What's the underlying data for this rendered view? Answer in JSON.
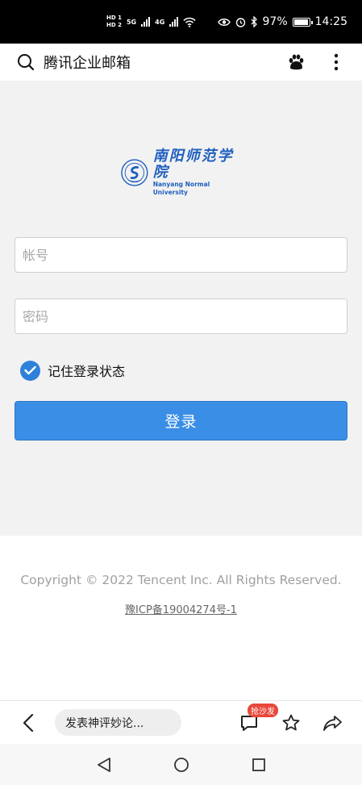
{
  "status_bar": {
    "sim1": "HD 1",
    "sim2": "HD 2",
    "net1": "5G",
    "net2": "4G",
    "battery": "97%",
    "time": "14:25",
    "battery_level": 0.97
  },
  "browser": {
    "title": "腾讯企业邮箱",
    "icons": [
      "search-icon",
      "paw-icon",
      "more-vertical-icon"
    ]
  },
  "logo": {
    "cn": "南阳师范学院",
    "en": "Nanyang Normal University"
  },
  "form": {
    "account_placeholder": "帐号",
    "account_value": "",
    "password_placeholder": "密码",
    "password_value": "",
    "remember_label": "记住登录状态",
    "remember_checked": true,
    "login_label": "登录"
  },
  "footer": {
    "copyright": "Copyright © 2022 Tencent Inc. All Rights Reserved.",
    "icp": "豫ICP备19004274号-1"
  },
  "toolbar": {
    "comment_placeholder": "发表神评妙论...",
    "badge": "抢沙发",
    "icons": [
      "back-icon",
      "comment-icon",
      "star-icon",
      "share-icon"
    ]
  },
  "navbar": {
    "icons": [
      "nav-back-icon",
      "nav-home-icon",
      "nav-recents-icon"
    ]
  },
  "colors": {
    "accent": "#3a8ee6",
    "checkbox": "#2f80d9",
    "logo": "#1f5fbf",
    "badge": "#e8483b"
  }
}
